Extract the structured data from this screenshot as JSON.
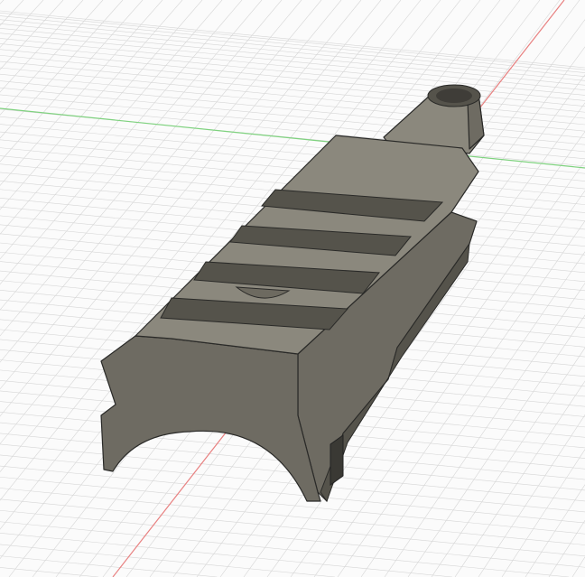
{
  "viewport": {
    "background": "#fbfbfb",
    "grid_color": "#d6d6d6",
    "x_axis_color": "#e88080",
    "y_axis_color": "#7fd27f"
  },
  "model": {
    "top_color": "#8b887d",
    "side_color": "#6e6b62",
    "dark_color": "#55534b",
    "edge_color": "#2a2a28"
  }
}
